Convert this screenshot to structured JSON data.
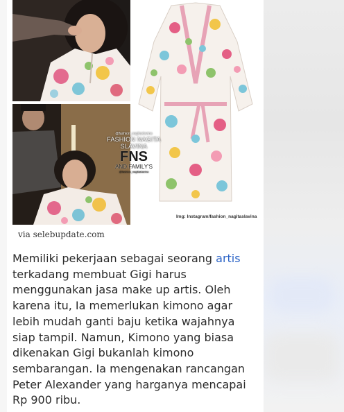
{
  "watermark": {
    "top": "@fashion_nagitaslavina",
    "line": "FASHION NAGITA SLAVINA",
    "big": "FNS",
    "family": "AND FAMILY'S",
    "handle": "@fashion_nagitaslavina"
  },
  "image_credit": "Img: Instagram/fashion_nagitaslavina",
  "source_label": "via selebupdate.com",
  "article": {
    "line1_pre": "Memiliki pekerjaan sebagai seorang ",
    "line1_link": "artis",
    "line2": "terkadang membuat Gigi harus",
    "line3": "menggunakan jasa make up artis. Oleh",
    "line4": "karena itu, Ia memerlukan kimono agar",
    "line5": "lebih mudah ganti baju ketika wajahnya",
    "line6": "siap tampil. Namun, Kimono yang biasa",
    "line7": "dikenakan Gigi bukanlah kimono",
    "line8": "sembarangan. Ia mengenakan rancangan",
    "line9": "Peter Alexander yang harganya mencapai",
    "line10": "Rp 900 ribu."
  },
  "colors": {
    "link": "#2b63c6",
    "text": "#2b2b2b"
  }
}
